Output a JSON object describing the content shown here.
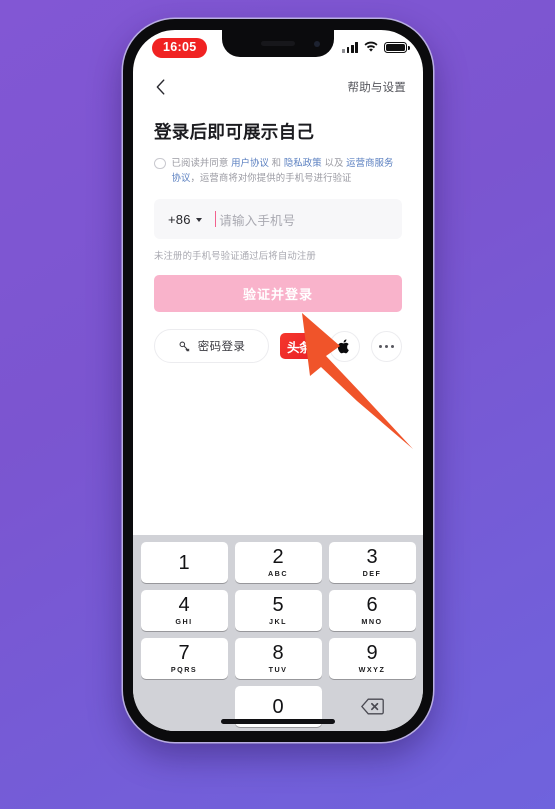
{
  "background": {
    "color_from": "#8257d4",
    "color_to": "#6f63dd"
  },
  "status_bar": {
    "time": "16:05",
    "time_badge_color": "#f02222",
    "signal_icon": "cellular-signal-icon",
    "wifi_icon": "wifi-icon",
    "battery_icon": "battery-full-icon"
  },
  "nav_bar": {
    "back_icon": "chevron-left-icon",
    "help_settings_label": "帮助与设置"
  },
  "login_page": {
    "title": "登录后即可展示自己",
    "agreement": {
      "checked": false,
      "prefix": "已阅读并同意 ",
      "link_user_agreement": "用户协议",
      "between_1": " 和 ",
      "link_privacy_policy": "隐私政策",
      "between_2": " 以及 ",
      "link_carrier_agreement": "运营商服务协议",
      "suffix": "，运营商将对你提供的手机号进行验证"
    },
    "phone_field": {
      "country_code": "+86",
      "chevron_icon": "chevron-down-icon",
      "placeholder": "请输入手机号",
      "value": "",
      "caret_color": "#f2618e",
      "background": "#f7f7f9"
    },
    "auto_register_hint": "未注册的手机号验证通过后将自动注册",
    "primary_button": {
      "label": "验证并登录",
      "background": "#f9b3cb",
      "text_color": "#ffffff",
      "enabled": false
    },
    "alt_login": {
      "password_login_label": "密码登录",
      "password_login_icon": "key-icon",
      "toutiao_label": "头条",
      "toutiao_color": "#e81f28",
      "apple_icon": "apple-logo-icon",
      "more_icon": "more-horizontal-icon"
    }
  },
  "keyboard": {
    "type": "numeric-phone-pad",
    "background": "#d1d2d7",
    "rows": [
      [
        {
          "num": "1",
          "sub": ""
        },
        {
          "num": "2",
          "sub": "ABC"
        },
        {
          "num": "3",
          "sub": "DEF"
        }
      ],
      [
        {
          "num": "4",
          "sub": "GHI"
        },
        {
          "num": "5",
          "sub": "JKL"
        },
        {
          "num": "6",
          "sub": "MNO"
        }
      ],
      [
        {
          "num": "7",
          "sub": "PQRS"
        },
        {
          "num": "8",
          "sub": "TUV"
        },
        {
          "num": "9",
          "sub": "WXYZ"
        }
      ]
    ],
    "zero_key": {
      "num": "0",
      "sub": ""
    },
    "delete_icon": "backspace-delete-icon"
  },
  "annotation": {
    "arrow_icon": "arrow-pointer-annotation",
    "arrow_color": "#f0542a",
    "points_at": "toutiao-login-button"
  },
  "home_indicator": "home-indicator-bar"
}
